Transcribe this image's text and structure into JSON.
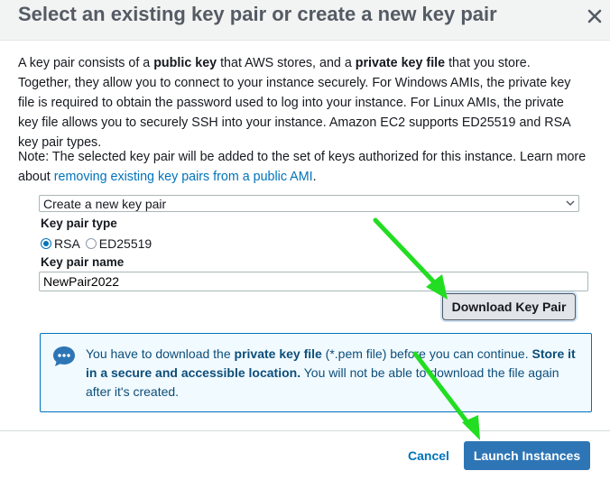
{
  "dialog": {
    "title": "Select an existing key pair or create a new key pair"
  },
  "intro": {
    "t1": "A key pair consists of a ",
    "b1": "public key",
    "t2": " that AWS stores, and a ",
    "b2": "private key file",
    "t3": " that you store. Together, they allow you to connect to your instance securely. For Windows AMIs, the private key file is required to obtain the password used to log into your instance. For Linux AMIs, the private key file allows you to securely SSH into your instance. Amazon EC2 supports ED25519 and RSA key pair types."
  },
  "note": {
    "text": "Note: The selected key pair will be added to the set of keys authorized for this instance. Learn more about ",
    "link": "removing existing key pairs from a public AMI",
    "end": "."
  },
  "key_select": {
    "selected": "Create a new key pair"
  },
  "key_type": {
    "label": "Key pair type",
    "options": [
      "RSA",
      "ED25519"
    ],
    "selected": "RSA"
  },
  "key_name": {
    "label": "Key pair name",
    "value": "NewPair2022"
  },
  "download_button": "Download Key Pair",
  "info": {
    "t1": "You have to download the ",
    "b1": "private key file",
    "t2": " (*.pem file) before you can continue. ",
    "b2": "Store it in a secure and accessible location.",
    "t3": " You will not be able to download the file again after it's created."
  },
  "footer": {
    "cancel": "Cancel",
    "launch": "Launch Instances"
  },
  "colors": {
    "arrow": "#22dd22",
    "link": "#0073bb",
    "launch": "#2e75b6"
  },
  "icons": [
    "close-icon",
    "chevron-down-icon",
    "chat-info-icon",
    "arrow-annotation"
  ]
}
